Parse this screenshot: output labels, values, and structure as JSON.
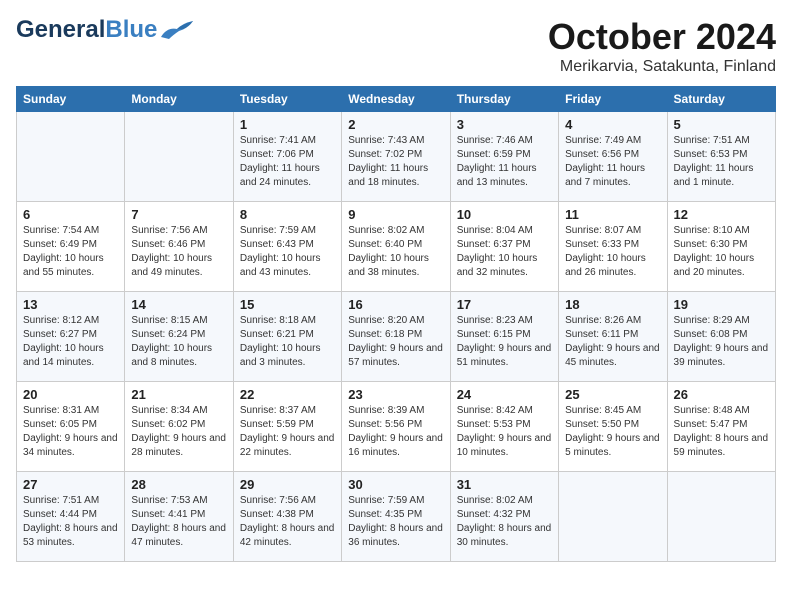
{
  "header": {
    "logo_general": "General",
    "logo_blue": "Blue",
    "month_title": "October 2024",
    "subtitle": "Merikarvia, Satakunta, Finland"
  },
  "columns": [
    "Sunday",
    "Monday",
    "Tuesday",
    "Wednesday",
    "Thursday",
    "Friday",
    "Saturday"
  ],
  "weeks": [
    [
      null,
      null,
      {
        "day": 1,
        "sunrise": "Sunrise: 7:41 AM",
        "sunset": "Sunset: 7:06 PM",
        "daylight": "Daylight: 11 hours and 24 minutes."
      },
      {
        "day": 2,
        "sunrise": "Sunrise: 7:43 AM",
        "sunset": "Sunset: 7:02 PM",
        "daylight": "Daylight: 11 hours and 18 minutes."
      },
      {
        "day": 3,
        "sunrise": "Sunrise: 7:46 AM",
        "sunset": "Sunset: 6:59 PM",
        "daylight": "Daylight: 11 hours and 13 minutes."
      },
      {
        "day": 4,
        "sunrise": "Sunrise: 7:49 AM",
        "sunset": "Sunset: 6:56 PM",
        "daylight": "Daylight: 11 hours and 7 minutes."
      },
      {
        "day": 5,
        "sunrise": "Sunrise: 7:51 AM",
        "sunset": "Sunset: 6:53 PM",
        "daylight": "Daylight: 11 hours and 1 minute."
      }
    ],
    [
      {
        "day": 6,
        "sunrise": "Sunrise: 7:54 AM",
        "sunset": "Sunset: 6:49 PM",
        "daylight": "Daylight: 10 hours and 55 minutes."
      },
      {
        "day": 7,
        "sunrise": "Sunrise: 7:56 AM",
        "sunset": "Sunset: 6:46 PM",
        "daylight": "Daylight: 10 hours and 49 minutes."
      },
      {
        "day": 8,
        "sunrise": "Sunrise: 7:59 AM",
        "sunset": "Sunset: 6:43 PM",
        "daylight": "Daylight: 10 hours and 43 minutes."
      },
      {
        "day": 9,
        "sunrise": "Sunrise: 8:02 AM",
        "sunset": "Sunset: 6:40 PM",
        "daylight": "Daylight: 10 hours and 38 minutes."
      },
      {
        "day": 10,
        "sunrise": "Sunrise: 8:04 AM",
        "sunset": "Sunset: 6:37 PM",
        "daylight": "Daylight: 10 hours and 32 minutes."
      },
      {
        "day": 11,
        "sunrise": "Sunrise: 8:07 AM",
        "sunset": "Sunset: 6:33 PM",
        "daylight": "Daylight: 10 hours and 26 minutes."
      },
      {
        "day": 12,
        "sunrise": "Sunrise: 8:10 AM",
        "sunset": "Sunset: 6:30 PM",
        "daylight": "Daylight: 10 hours and 20 minutes."
      }
    ],
    [
      {
        "day": 13,
        "sunrise": "Sunrise: 8:12 AM",
        "sunset": "Sunset: 6:27 PM",
        "daylight": "Daylight: 10 hours and 14 minutes."
      },
      {
        "day": 14,
        "sunrise": "Sunrise: 8:15 AM",
        "sunset": "Sunset: 6:24 PM",
        "daylight": "Daylight: 10 hours and 8 minutes."
      },
      {
        "day": 15,
        "sunrise": "Sunrise: 8:18 AM",
        "sunset": "Sunset: 6:21 PM",
        "daylight": "Daylight: 10 hours and 3 minutes."
      },
      {
        "day": 16,
        "sunrise": "Sunrise: 8:20 AM",
        "sunset": "Sunset: 6:18 PM",
        "daylight": "Daylight: 9 hours and 57 minutes."
      },
      {
        "day": 17,
        "sunrise": "Sunrise: 8:23 AM",
        "sunset": "Sunset: 6:15 PM",
        "daylight": "Daylight: 9 hours and 51 minutes."
      },
      {
        "day": 18,
        "sunrise": "Sunrise: 8:26 AM",
        "sunset": "Sunset: 6:11 PM",
        "daylight": "Daylight: 9 hours and 45 minutes."
      },
      {
        "day": 19,
        "sunrise": "Sunrise: 8:29 AM",
        "sunset": "Sunset: 6:08 PM",
        "daylight": "Daylight: 9 hours and 39 minutes."
      }
    ],
    [
      {
        "day": 20,
        "sunrise": "Sunrise: 8:31 AM",
        "sunset": "Sunset: 6:05 PM",
        "daylight": "Daylight: 9 hours and 34 minutes."
      },
      {
        "day": 21,
        "sunrise": "Sunrise: 8:34 AM",
        "sunset": "Sunset: 6:02 PM",
        "daylight": "Daylight: 9 hours and 28 minutes."
      },
      {
        "day": 22,
        "sunrise": "Sunrise: 8:37 AM",
        "sunset": "Sunset: 5:59 PM",
        "daylight": "Daylight: 9 hours and 22 minutes."
      },
      {
        "day": 23,
        "sunrise": "Sunrise: 8:39 AM",
        "sunset": "Sunset: 5:56 PM",
        "daylight": "Daylight: 9 hours and 16 minutes."
      },
      {
        "day": 24,
        "sunrise": "Sunrise: 8:42 AM",
        "sunset": "Sunset: 5:53 PM",
        "daylight": "Daylight: 9 hours and 10 minutes."
      },
      {
        "day": 25,
        "sunrise": "Sunrise: 8:45 AM",
        "sunset": "Sunset: 5:50 PM",
        "daylight": "Daylight: 9 hours and 5 minutes."
      },
      {
        "day": 26,
        "sunrise": "Sunrise: 8:48 AM",
        "sunset": "Sunset: 5:47 PM",
        "daylight": "Daylight: 8 hours and 59 minutes."
      }
    ],
    [
      {
        "day": 27,
        "sunrise": "Sunrise: 7:51 AM",
        "sunset": "Sunset: 4:44 PM",
        "daylight": "Daylight: 8 hours and 53 minutes."
      },
      {
        "day": 28,
        "sunrise": "Sunrise: 7:53 AM",
        "sunset": "Sunset: 4:41 PM",
        "daylight": "Daylight: 8 hours and 47 minutes."
      },
      {
        "day": 29,
        "sunrise": "Sunrise: 7:56 AM",
        "sunset": "Sunset: 4:38 PM",
        "daylight": "Daylight: 8 hours and 42 minutes."
      },
      {
        "day": 30,
        "sunrise": "Sunrise: 7:59 AM",
        "sunset": "Sunset: 4:35 PM",
        "daylight": "Daylight: 8 hours and 36 minutes."
      },
      {
        "day": 31,
        "sunrise": "Sunrise: 8:02 AM",
        "sunset": "Sunset: 4:32 PM",
        "daylight": "Daylight: 8 hours and 30 minutes."
      },
      null,
      null
    ]
  ]
}
